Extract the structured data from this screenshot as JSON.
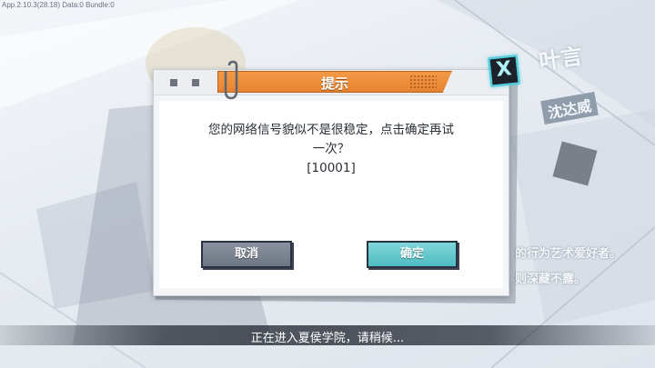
{
  "version_text": "App.2.10.3(28.18) Data:0 Bundle:0",
  "background": {
    "character_name": "叶言",
    "tag": "沈达威",
    "quote_line1": "的行为艺术爱好者。",
    "quote_line2": "则深藏不露。"
  },
  "dialog": {
    "title": "提示",
    "message_line1": "您的网络信号貌似不是很稳定，点击确定再试",
    "message_line2": "一次？",
    "error_code": "[10001]",
    "cancel_label": "取消",
    "confirm_label": "确定",
    "close_glyph": "X"
  },
  "status": {
    "loading_text": "正在进入夏侯学院，请稍候..."
  },
  "colors": {
    "title_orange": "#e7822f",
    "confirm_teal": "#4fbcc2",
    "cancel_gray": "#6d7684",
    "close_cyan": "#4fd3e0"
  }
}
